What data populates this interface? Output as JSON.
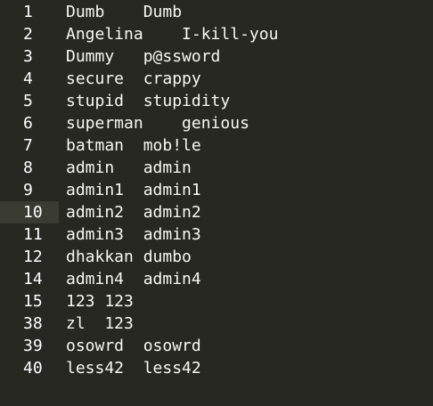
{
  "editor": {
    "lines": [
      {
        "no": "1",
        "text": "Dumb    Dumb"
      },
      {
        "no": "2",
        "text": "Angelina    I-kill-you"
      },
      {
        "no": "3",
        "text": "Dummy   p@ssword"
      },
      {
        "no": "4",
        "text": "secure  crappy"
      },
      {
        "no": "5",
        "text": "stupid  stupidity"
      },
      {
        "no": "6",
        "text": "superman    genious"
      },
      {
        "no": "7",
        "text": "batman  mob!le"
      },
      {
        "no": "8",
        "text": "admin   admin"
      },
      {
        "no": "9",
        "text": "admin1  admin1"
      },
      {
        "no": "10",
        "text": "admin2  admin2"
      },
      {
        "no": "11",
        "text": "admin3  admin3"
      },
      {
        "no": "12",
        "text": "dhakkan dumbo"
      },
      {
        "no": "14",
        "text": "admin4  admin4"
      },
      {
        "no": "15",
        "text": "123 123"
      },
      {
        "no": "38",
        "text": "zl  123"
      },
      {
        "no": "39",
        "text": "osowrd  osowrd"
      },
      {
        "no": "40",
        "text": "less42  less42"
      }
    ]
  }
}
